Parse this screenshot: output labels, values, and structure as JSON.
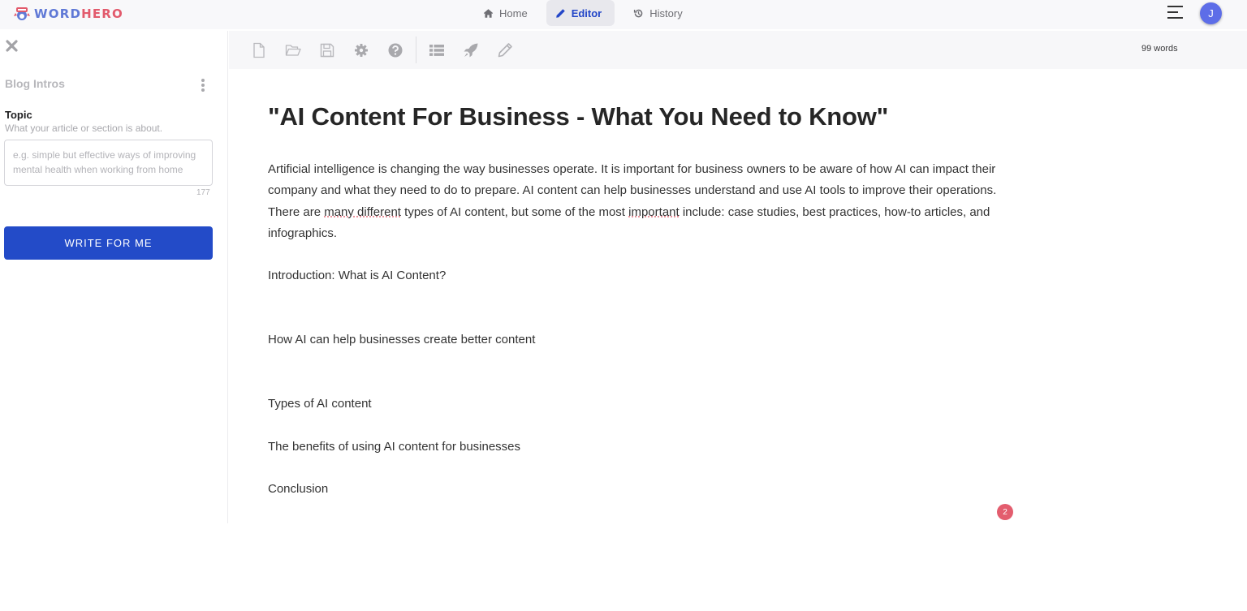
{
  "brand": {
    "name_part1": "WORD",
    "name_part2": "HERO",
    "colors": {
      "blue": "#6079d6",
      "red": "#e25a6c"
    }
  },
  "nav": {
    "items": [
      {
        "label": "Home",
        "icon": "home-icon",
        "active": false
      },
      {
        "label": "Editor",
        "icon": "pencil-icon",
        "active": true
      },
      {
        "label": "History",
        "icon": "history-icon",
        "active": false
      }
    ]
  },
  "user": {
    "initial": "J",
    "avatar_color": "#5d6de8"
  },
  "panel": {
    "title": "Blog Intros",
    "field_label": "Topic",
    "field_help": "What your article or section is about.",
    "input_value": "",
    "input_placeholder": "e.g. simple but effective ways of improving mental health when working from home",
    "char_count": "177",
    "write_button": "WRITE FOR ME",
    "accent": "#234bc8"
  },
  "toolbar": {
    "buttons": [
      "new-document",
      "open-folder",
      "save",
      "settings",
      "help",
      "list",
      "rocket",
      "pencil"
    ],
    "word_count": "99 words"
  },
  "document": {
    "title": "\"AI Content For Business - What You Need to Know\"",
    "paragraph": {
      "part1": " Artificial intelligence is changing the way businesses operate. It is important for business owners to be aware of how AI can impact their company and what they need to do to prepare. AI content can help businesses understand and use AI tools to improve their operations. There are ",
      "spell1": "many different",
      "part2": " types of AI content, but some of the most ",
      "spell2": "important",
      "part3": " include: case studies, best practices, how-to articles, and infographics."
    },
    "lines": [
      "Introduction: What is AI Content?",
      "How AI can help businesses create better content",
      "Types of AI content",
      "The benefits of using AI content for businesses",
      "Conclusion"
    ]
  },
  "notification_badge": "2"
}
